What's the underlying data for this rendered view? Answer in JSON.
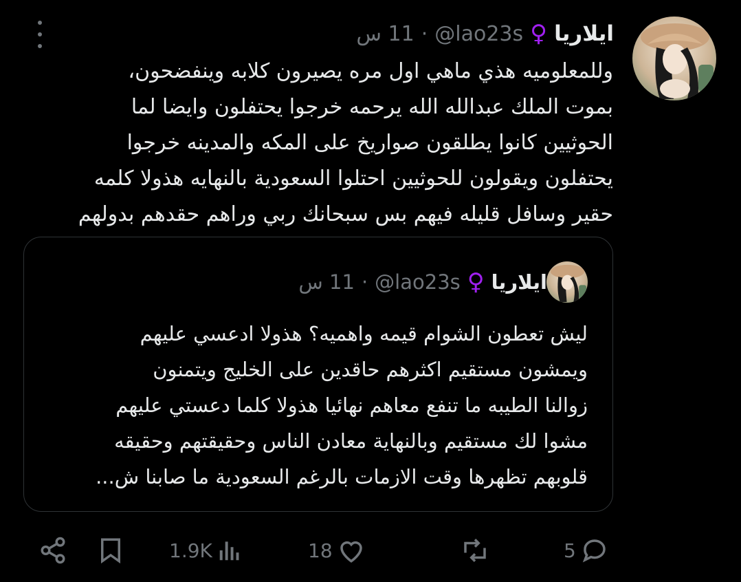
{
  "tweet": {
    "author_name": "ايلاريا",
    "gender_symbol": "♀",
    "handle": "@lao23s",
    "dot": "·",
    "time": "11 س",
    "text_lines": [
      "وللمعلوميه هذي ماهي اول مره يصيرون كلابه وينفضحون،",
      "بموت الملك عبدالله الله يرحمه خرجوا يحتفلون وايضا لما",
      "الحوثيين كانوا يطلقون صواريخ على المكه والمدينه خرجوا",
      "يحتفلون ويقولون للحوثيين احتلوا السعودية بالنهايه هذولا كلمه",
      "حقير وسافل قليله فيهم بس سبحانك ربي وراهم حقدهم بدولهم"
    ]
  },
  "quoted": {
    "author_name": "ايلاريا",
    "gender_symbol": "♀",
    "handle": "@lao23s",
    "dot": "·",
    "time": "11 س",
    "text_lines": [
      "ليش تعطون الشوام قيمه واهميه؟ هذولا ادعسي عليهم",
      "ويمشون مستقيم اكثرهم حاقدين على الخليج ويتمنون",
      "زوالنا الطيبه ما تنفع معاهم نهائيا هذولا كلما دعستي عليهم",
      "مشوا لك مستقيم وبالنهاية معادن الناس وحقيقتهم وحقيقه",
      "قلوبهم تظهرها وقت الازمات بالرغم السعودية ما صابنا ش..."
    ]
  },
  "actions": {
    "views": "1.9K",
    "likes": "18",
    "retweets": "",
    "replies": "5"
  },
  "colors": {
    "background": "#000000",
    "text": "#e7e9ea",
    "muted": "#71767b",
    "gender": "#a020f0",
    "border": "#2f3336"
  }
}
